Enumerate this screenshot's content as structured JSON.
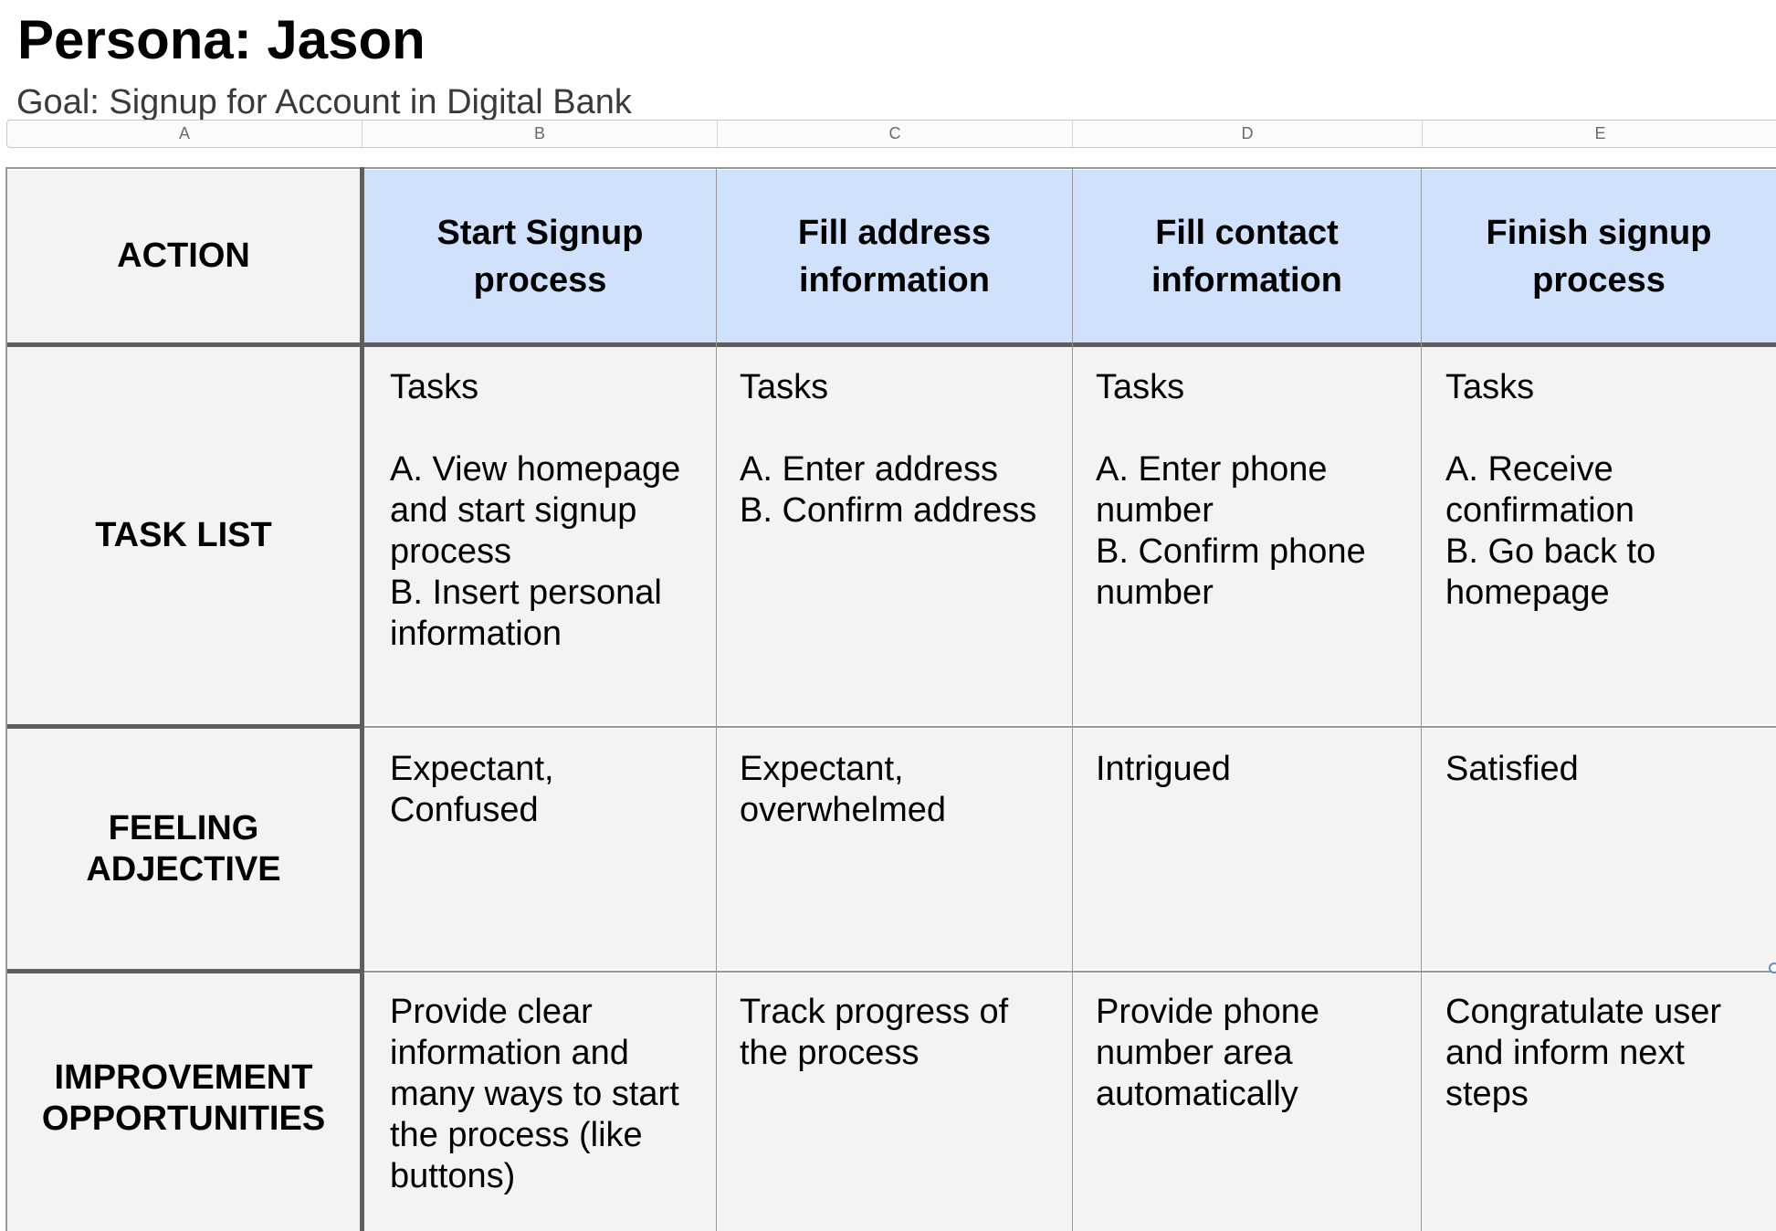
{
  "title": "Persona: Jason",
  "subtitle": "Goal: Signup for Account in Digital Bank",
  "column_letters": [
    "A",
    "B",
    "C",
    "D",
    "E"
  ],
  "header_label": "ACTION",
  "stages": [
    "Start Signup process",
    "Fill address information",
    "Fill contact information",
    "Finish signup process"
  ],
  "rows": [
    {
      "label": "TASK LIST",
      "cells": [
        "Tasks\n\nA. View homepage and start signup process\nB. Insert personal information",
        "Tasks\n\nA. Enter address\nB. Confirm address",
        "Tasks\n\nA. Enter phone number\nB. Confirm phone number",
        "Tasks\n\nA. Receive confirmation\nB. Go back to homepage"
      ]
    },
    {
      "label": "FEELING ADJECTIVE",
      "cells": [
        "Expectant, Confused",
        "Expectant, overwhelmed",
        "Intrigued",
        "Satisfied"
      ]
    },
    {
      "label": "IMPROVEMENT OPPORTUNITIES",
      "cells": [
        "Provide clear information and many ways to start the process (like buttons)",
        "Track progress of the process",
        "Provide phone number area automatically",
        "Congratulate user and inform next steps"
      ]
    }
  ]
}
